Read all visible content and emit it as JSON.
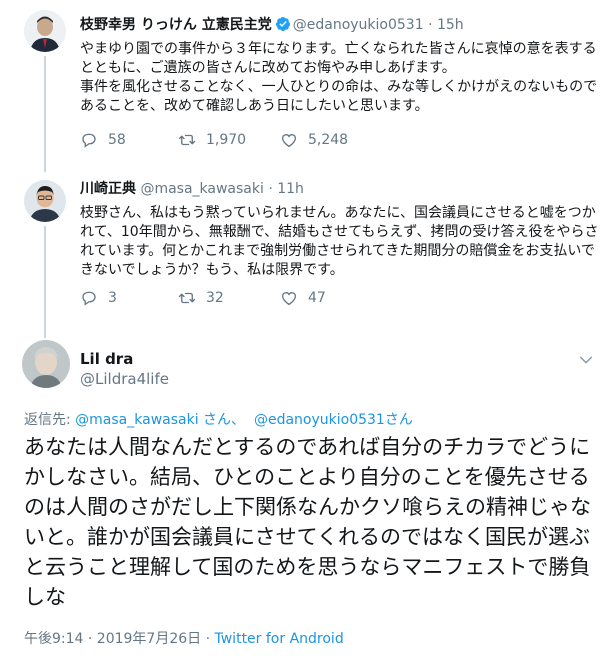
{
  "tweet1": {
    "name": "枝野幸男 りっけん 立憲民主党",
    "handle": "@edanoyukio0531",
    "time": "· 15h",
    "text": "やまゆり園での事件から３年になります。亡くなられた皆さんに哀悼の意を表するとともに、ご遺族の皆さんに改めてお悔やみ申しあげます。\n事件を風化させることなく、一人ひとりの命は、みな等しくかけがえのないものであることを、改めて確認しあう日にしたいと思います。",
    "replies": "58",
    "retweets": "1,970",
    "likes": "5,248"
  },
  "tweet2": {
    "name": "川崎正典",
    "handle": "@masa_kawasaki",
    "time": "· 11h",
    "text": "枝野さん、私はもう黙っていられません。あなたに、国会議員にさせると嘘をつかれて、10年間から、無報酬で、結婚もさせてもらえず、拷問の受け答え役をやらされています。何とかこれまで強制労働させられてきた期間分の賠償金をお支払いできないでしょうか？もう、私は限界です。",
    "replies": "3",
    "retweets": "32",
    "likes": "47"
  },
  "tweet3": {
    "name": "Lil dra",
    "handle": "@Lildra4life",
    "reply_prefix": "返信先: ",
    "reply_to_1": "@masa_kawasaki さん、",
    "reply_to_2": "@edanoyukio0531さん",
    "text": "あなたは人間なんだとするのであれば自分のチカラでどうにかしなさい。結局、ひとのことより自分のことを優先させるのは人間のさがだし上下関係なんかクソ喰らえの精神じゃないと。誰かが国会議員にさせてくれるのではなく国民が選ぶと云うこと理解して国のためを思うならマニフェストで勝負しな",
    "timestamp": "午後9:14 · 2019年7月26日 · ",
    "client": "Twitter for Android"
  },
  "colors": {
    "link": "#1b95e0",
    "meta": "#657786",
    "verified": "#1da1f2"
  },
  "icons": [
    "verified-icon",
    "reply-icon",
    "retweet-icon",
    "like-icon",
    "chevron-down-icon"
  ]
}
